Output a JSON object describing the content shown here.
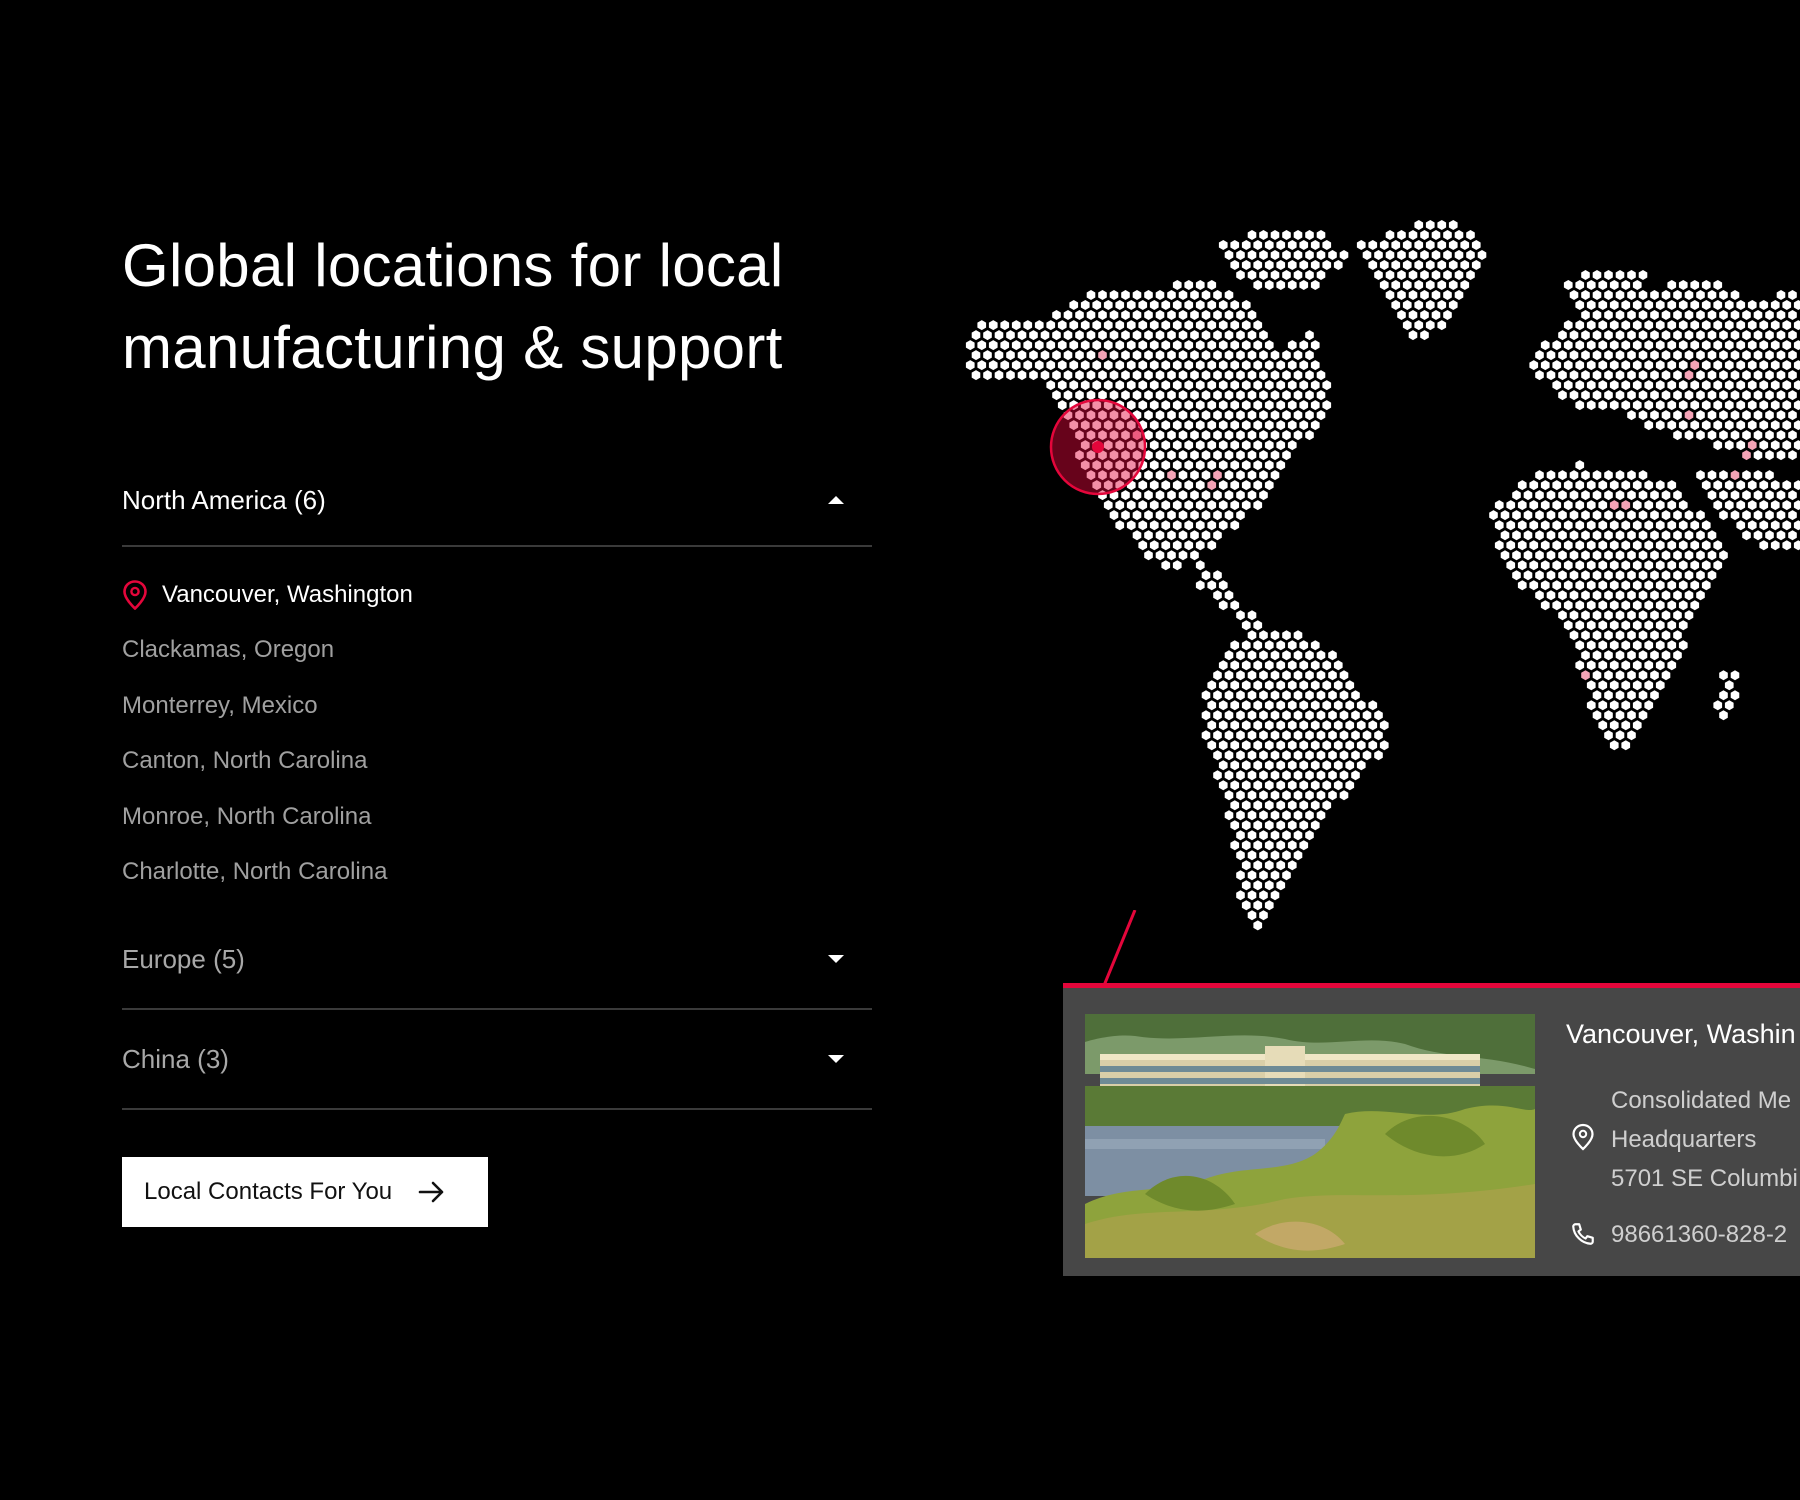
{
  "headline": {
    "line1": "Global locations for local",
    "line2": "manufacturing & support"
  },
  "regions": [
    {
      "label": "North America (6)",
      "expanded": true,
      "locations": [
        "Vancouver, Washington",
        "Clackamas, Oregon",
        "Monterrey, Mexico",
        "Canton, North Carolina",
        "Monroe, North Carolina",
        "Charlotte, North Carolina"
      ],
      "active_location": "Vancouver, Washington"
    },
    {
      "label": "Europe (5)",
      "expanded": false
    },
    {
      "label": "China (3)",
      "expanded": false
    }
  ],
  "cta": {
    "label": "Local Contacts For You",
    "icon": "arrow-right-icon"
  },
  "detail_card": {
    "title": "Vancouver, Washin",
    "address_lines": [
      "Consolidated Me",
      "Headquarters",
      "5701 SE Columbi"
    ],
    "phone": "98661360-828-2",
    "icons": {
      "address": "location-pin-icon",
      "phone": "phone-icon"
    }
  },
  "colors": {
    "background": "#000000",
    "accent": "#e4063b",
    "card_background": "#474747",
    "map_dot": "#ffffff",
    "map_highlight": "#f4a3b6",
    "muted_text": "#a0a0a0"
  }
}
